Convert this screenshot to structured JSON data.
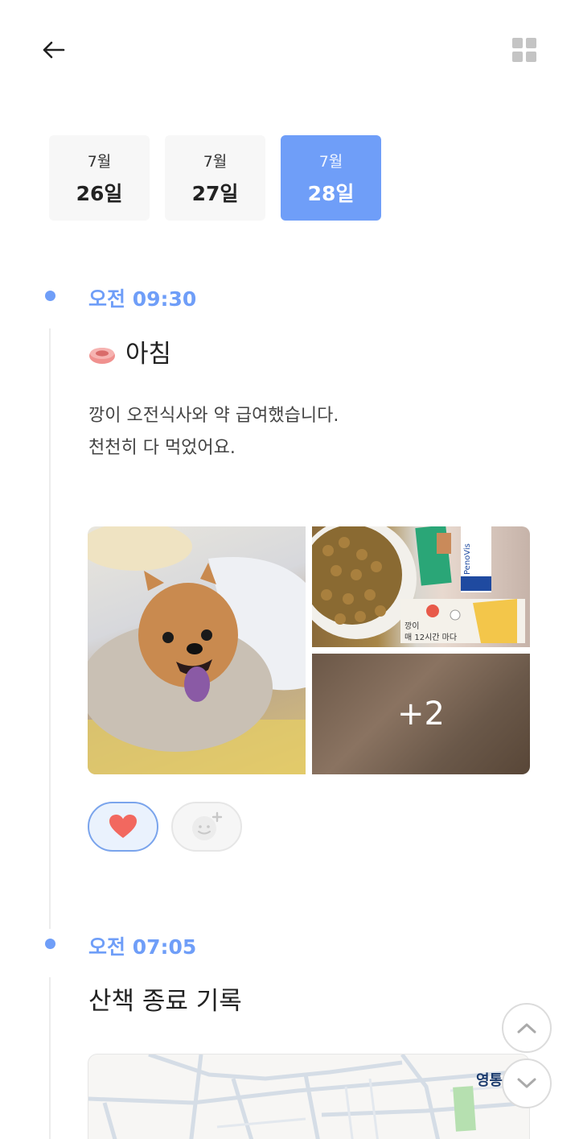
{
  "header": {
    "back_icon": "arrow-left-icon",
    "grid_icon": "grid-view-icon"
  },
  "date_tabs": [
    {
      "month": "7월",
      "day": "26일",
      "active": false
    },
    {
      "month": "7월",
      "day": "27일",
      "active": false
    },
    {
      "month": "7월",
      "day": "28일",
      "active": true
    }
  ],
  "colors": {
    "accent": "#6f9ef8",
    "heart": "#f2685f"
  },
  "entries": [
    {
      "time": "오전 09:30",
      "icon": "food-bowl-icon",
      "title": "아침",
      "description": [
        "깡이 오전식사와 약 급여했습니다.",
        "천천히 다 먹었어요."
      ],
      "photos": {
        "more_count": "+2",
        "medicine_label_1": "깡이",
        "medicine_label_2": "매  12시간  마다",
        "package_brand": "PenoVis"
      },
      "reactions": [
        "heart-icon",
        "add-emoji-icon"
      ]
    },
    {
      "time": "오전 07:05",
      "title": "산책 종료 기록",
      "map": {
        "place_label": "영통"
      }
    }
  ],
  "scroll_buttons": [
    "chevron-up-icon",
    "chevron-down-icon"
  ]
}
